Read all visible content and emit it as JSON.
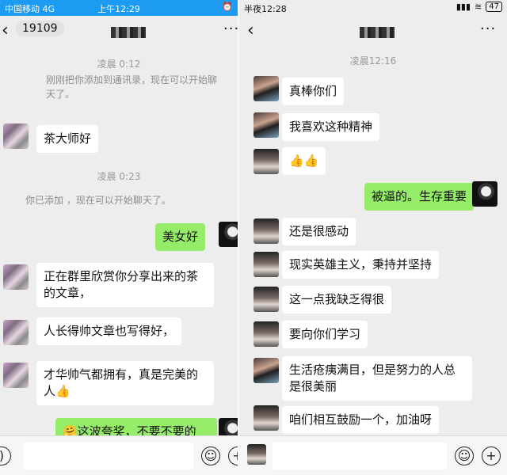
{
  "left": {
    "status": {
      "carrier": "中国移动",
      "network": "4G",
      "time": "上午12:29"
    },
    "unread_count": "19109",
    "timestamps": [
      "凌晨 0:12",
      "凌晨 0:23"
    ],
    "system_msgs": [
      "刚刚把你添加到通讯录，现在可以开始聊天了。",
      "你已添加 ，现在可以开始聊天了。"
    ],
    "messages": [
      {
        "side": "left",
        "text": "茶大师好"
      },
      {
        "side": "right",
        "text": "美女好"
      },
      {
        "side": "left",
        "text": "正在群里欣赏你分享出来的茶的文章，"
      },
      {
        "side": "left",
        "text": "人长得帅文章也写得好，"
      },
      {
        "side": "left",
        "text": "才华帅气都拥有，真是完美的人👍"
      },
      {
        "side": "right",
        "text": "🤗这波夸奖，不要不要的"
      }
    ]
  },
  "right": {
    "status": {
      "time": "半夜12:28",
      "battery": "47"
    },
    "timestamp": "凌晨12:16",
    "messages": [
      {
        "side": "left",
        "text": "真棒你们"
      },
      {
        "side": "left",
        "text": "我喜欢这种精神"
      },
      {
        "side": "left",
        "text": "👍👍"
      },
      {
        "side": "right",
        "text": "被逼的。生存重要"
      },
      {
        "side": "left",
        "text": "还是很感动"
      },
      {
        "side": "left",
        "text": "现实英雄主义，秉持并坚持"
      },
      {
        "side": "left",
        "text": "这一点我缺乏得很"
      },
      {
        "side": "left",
        "text": "要向你们学习"
      },
      {
        "side": "left",
        "text": "生活疮痍满目，但是努力的人总是很美丽"
      },
      {
        "side": "left",
        "text": "咱们相互鼓励一个，加油呀"
      }
    ]
  },
  "icons": {
    "back": "‹",
    "more": "···",
    "emoji": "☺",
    "plus": "+",
    "voice": ")"
  }
}
